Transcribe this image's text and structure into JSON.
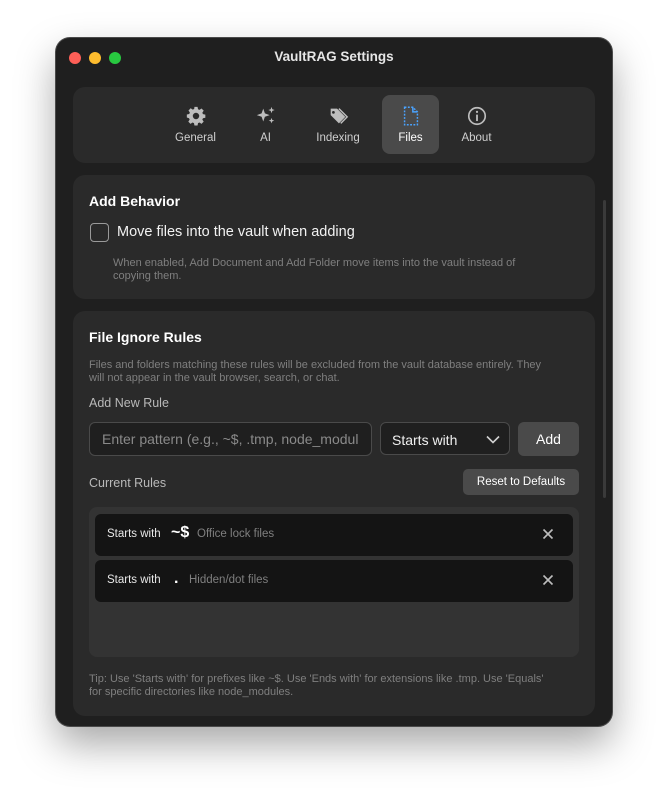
{
  "window": {
    "title": "VaultRAG Settings"
  },
  "tabs": [
    {
      "label": "General",
      "icon": "gear-icon",
      "active": false
    },
    {
      "label": "AI",
      "icon": "sparkles-icon",
      "active": false
    },
    {
      "label": "Indexing",
      "icon": "tags-icon",
      "active": false
    },
    {
      "label": "Files",
      "icon": "document-icon",
      "active": true
    },
    {
      "label": "About",
      "icon": "info-icon",
      "active": false
    }
  ],
  "add_behavior": {
    "title": "Add Behavior",
    "checkbox_label": "Move files into the vault when adding",
    "checked": false,
    "help_line1": "When enabled, Add Document and Add Folder move items into the vault instead of",
    "help_line2": "copying them."
  },
  "ignore_rules": {
    "title": "File Ignore Rules",
    "description_line1": "Files and folders matching these rules will be excluded from the vault database entirely. They",
    "description_line2": "will not appear in the vault browser, search, or chat.",
    "add_rule_label": "Add New Rule",
    "pattern_placeholder": "Enter pattern (e.g., ~$, .tmp, node_modules)",
    "pattern_value": "",
    "match_mode": "Starts with",
    "add_button": "Add",
    "current_rules_label": "Current Rules",
    "reset_button": "Reset to Defaults",
    "rules": [
      {
        "mode": "Starts with",
        "pattern": "~$",
        "description": "Office lock files"
      },
      {
        "mode": "Starts with",
        "pattern": ".",
        "description": "Hidden/dot files"
      }
    ],
    "tip_line1": "Tip: Use 'Starts with' for prefixes like ~$. Use 'Ends with' for extensions like .tmp. Use 'Equals'",
    "tip_line2": "for specific directories like node_modules."
  },
  "colors": {
    "accent": "#4aa3ff",
    "window_bg": "#1f1f1f",
    "card_bg": "#2a2a2a"
  }
}
